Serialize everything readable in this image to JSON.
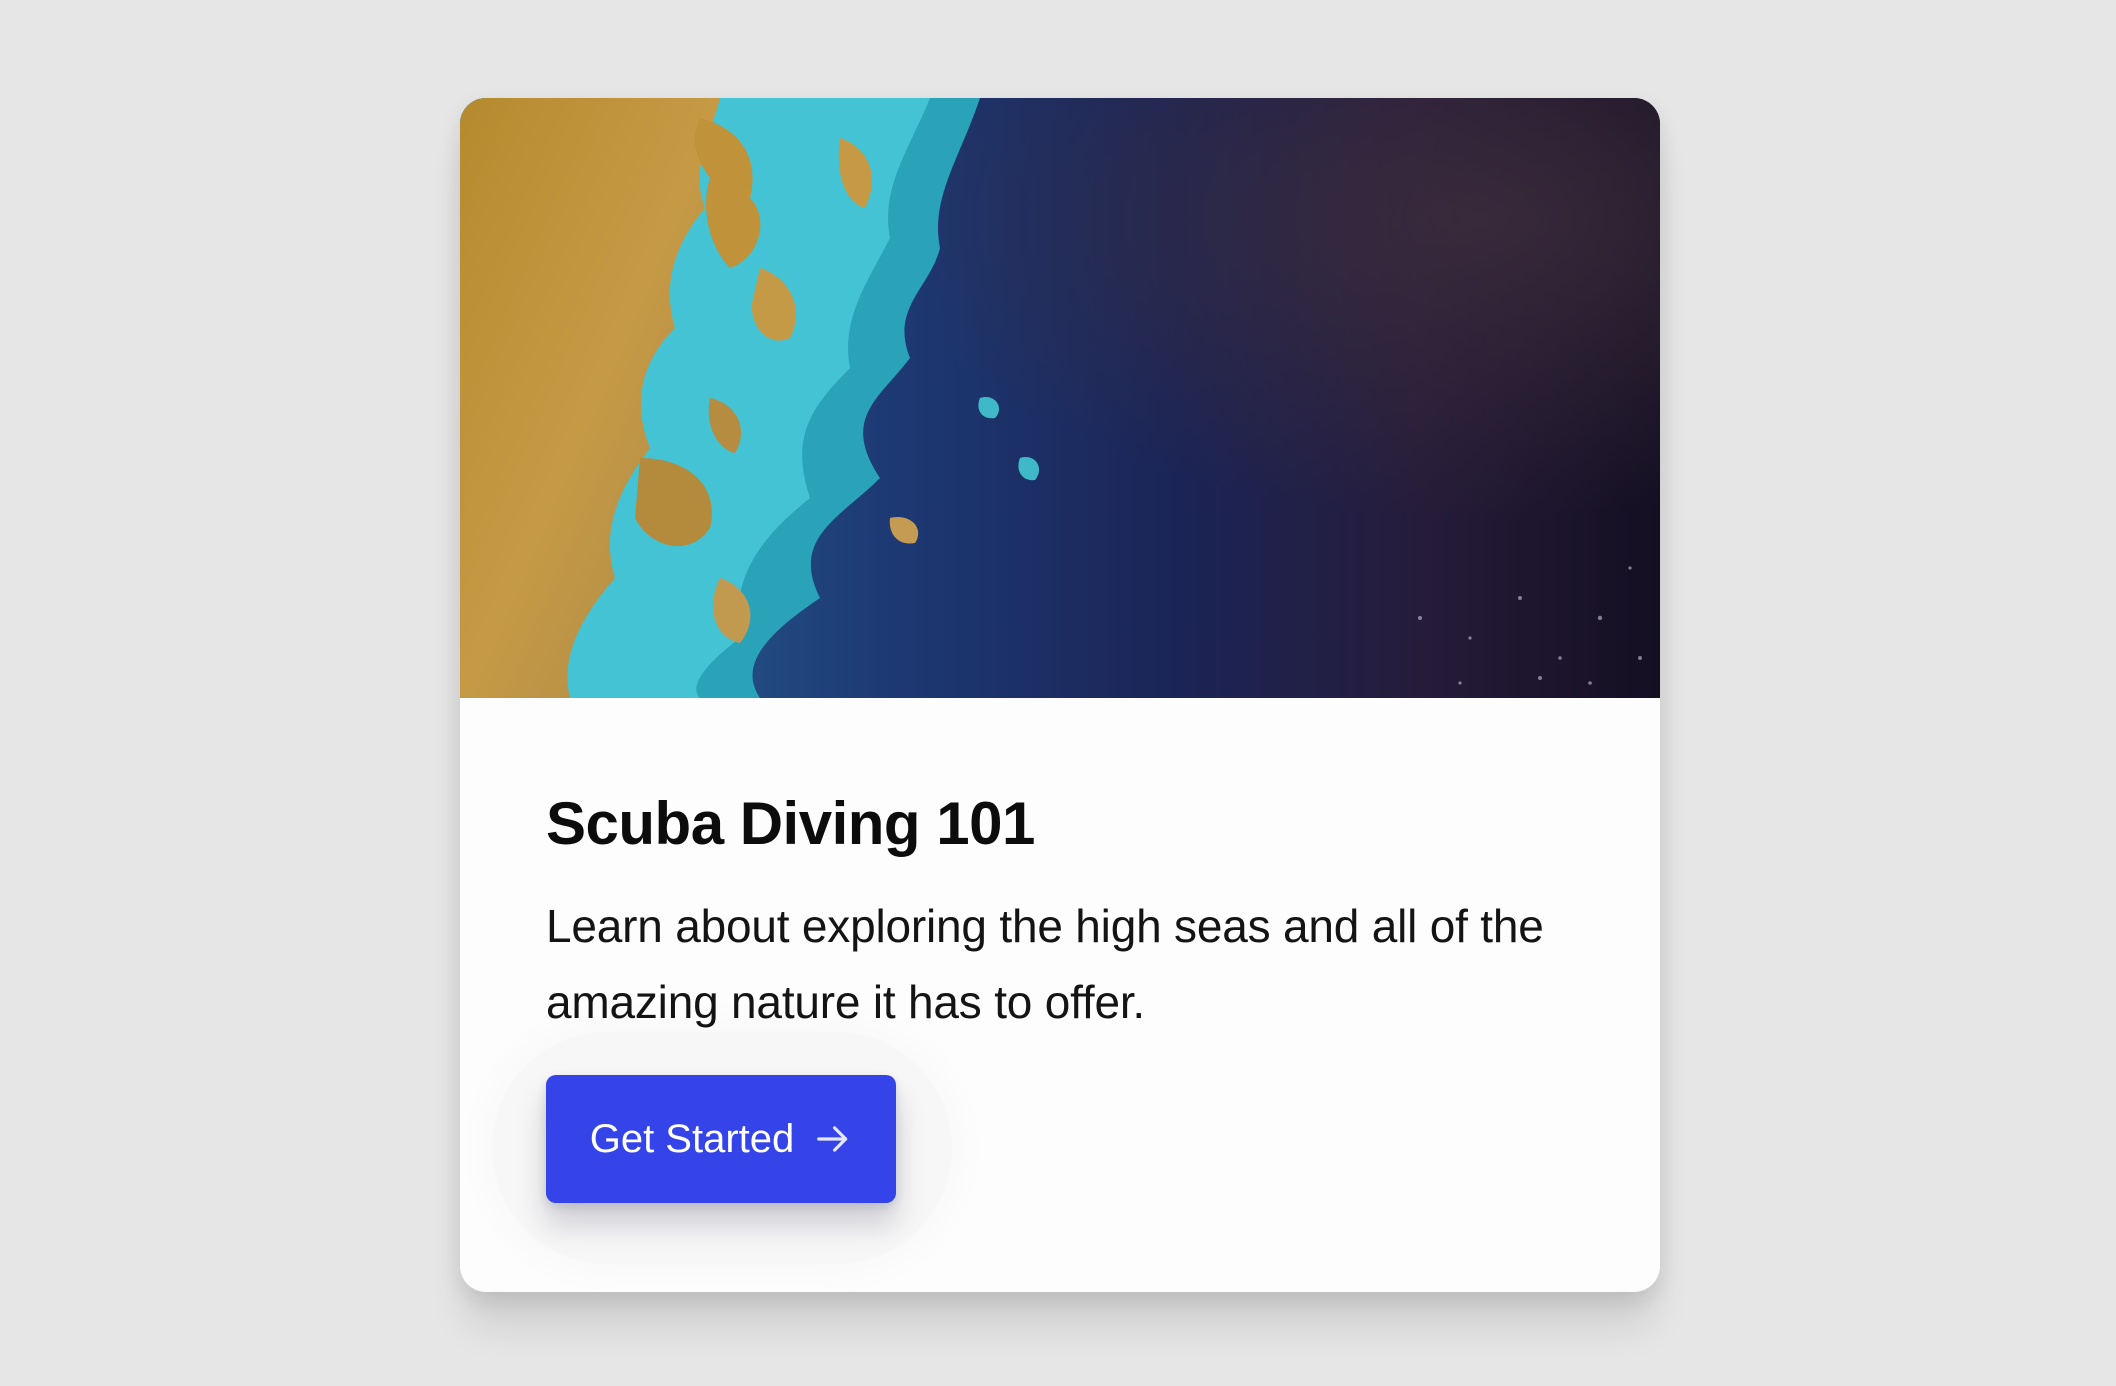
{
  "card": {
    "image_alt": "satellite-ocean-coastline-image",
    "title": "Scuba Diving 101",
    "description": "Learn about exploring the high seas and all of the amazing nature it has to offer.",
    "button": {
      "label": "Get Started",
      "icon": "arrow-right-icon"
    }
  },
  "colors": {
    "page_background": "#e6e6e6",
    "card_background": "#fdfdfd",
    "button_background": "#3544e8",
    "button_text": "#ffffff",
    "title_text": "#0c0c0c"
  }
}
